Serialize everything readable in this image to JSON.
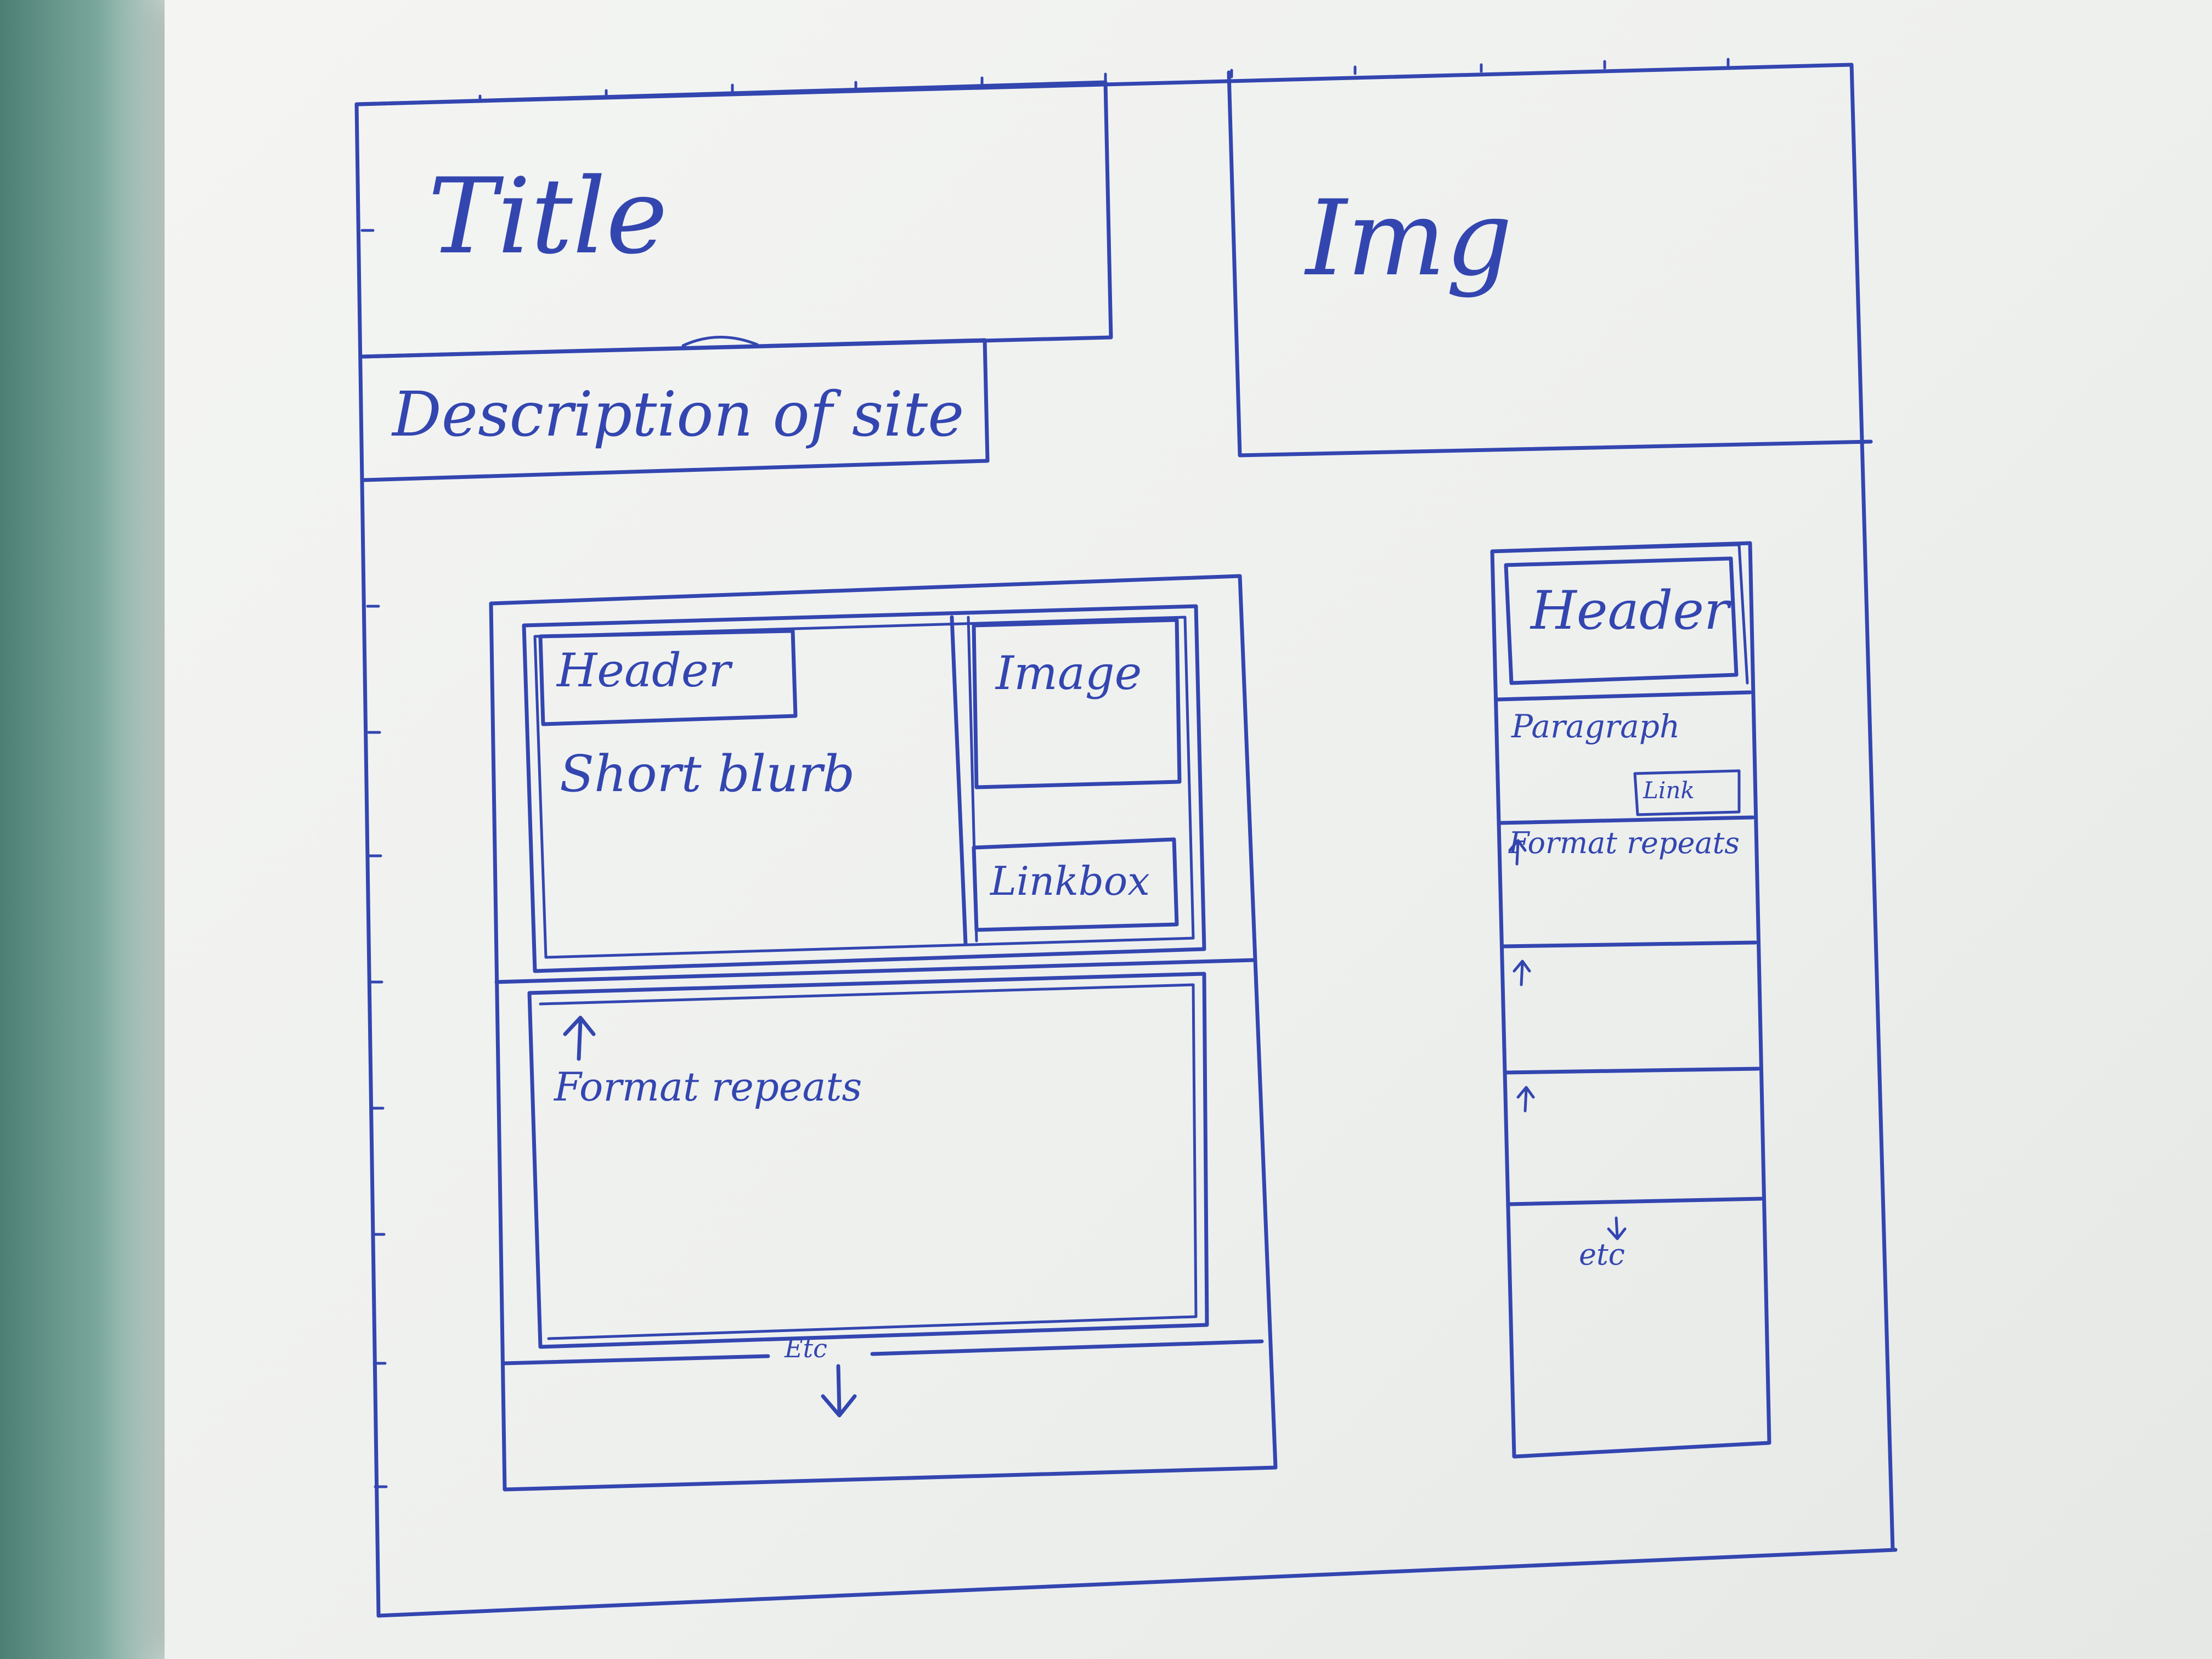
{
  "sketch": {
    "labels": {
      "title": "Title",
      "img": "Img",
      "description": "Description of site",
      "left_header": "Header",
      "short_blurb": "Short blurb",
      "image": "Image",
      "linkbox": "Linkbox",
      "left_format_repeats": "Format repeats",
      "left_etc": "Etc",
      "right_header": "Header",
      "paragraph": "Paragraph",
      "link": "Link",
      "right_format_repeats": "Format repeats",
      "right_etc": "etc"
    },
    "ink_color": "#3346b0",
    "paper_color": "#eef0ee"
  }
}
